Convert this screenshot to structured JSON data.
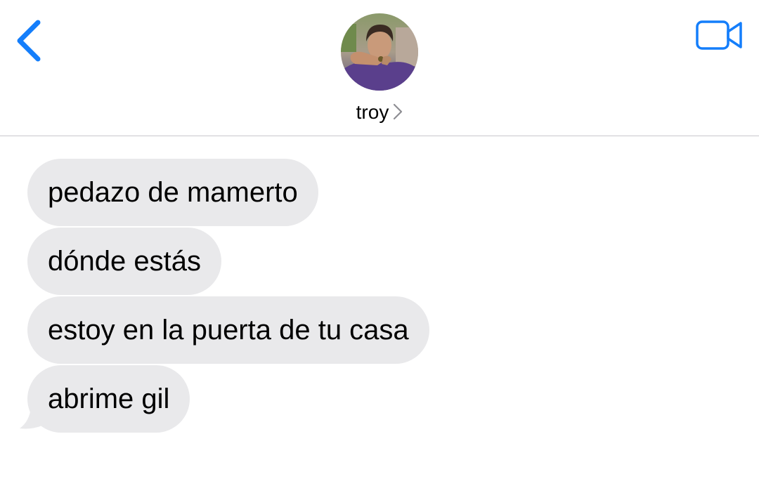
{
  "header": {
    "back_icon": "chevron-left-icon",
    "contact_name": "troy",
    "contact_chevron_icon": "chevron-right-icon",
    "video_icon": "video-camera-icon",
    "accent_color": "#147efb"
  },
  "messages": [
    {
      "sender": "troy",
      "direction": "incoming",
      "text": "pedazo de mamerto"
    },
    {
      "sender": "troy",
      "direction": "incoming",
      "text": "dónde estás"
    },
    {
      "sender": "troy",
      "direction": "incoming",
      "text": "estoy en la puerta de tu casa"
    },
    {
      "sender": "troy",
      "direction": "incoming",
      "text": "abrime gil"
    }
  ],
  "colors": {
    "incoming_bubble": "#e9e9eb",
    "divider": "#c8c7cc"
  }
}
